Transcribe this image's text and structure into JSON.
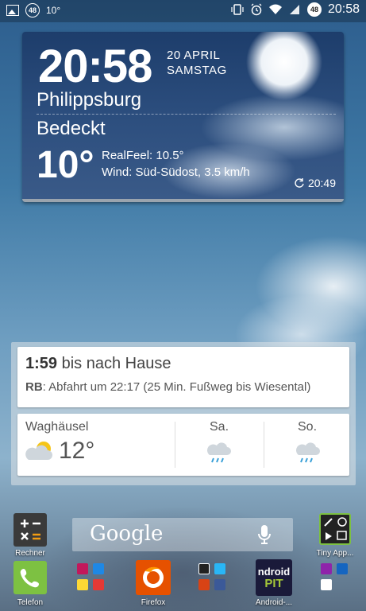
{
  "status_bar": {
    "notif_count": "48",
    "temp": "10°",
    "battery": "48",
    "time": "20:58"
  },
  "weather_widget": {
    "time": "20:58",
    "date_line1": "20 APRIL",
    "date_line2": "SAMSTAG",
    "city": "Philippsburg",
    "condition": "Bedeckt",
    "temperature": "10°",
    "realfeel": "RealFeel: 10.5°",
    "wind": "Wind: Süd-Südost, 3.5 km/h",
    "updated": "20:49"
  },
  "commute_card": {
    "time_bold": "1:59",
    "title_rest": " bis nach Hause",
    "mode": "RB",
    "detail": ": Abfahrt um 22:17 (25 Min. Fußweg bis Wiesental)"
  },
  "weather_card": {
    "city": "Waghäusel",
    "temp": "12°",
    "day1": "Sa.",
    "day2": "So."
  },
  "apps": {
    "calculator": "Rechner",
    "tiny": "Tiny App...",
    "phone": "Telefon",
    "firefox": "Firefox",
    "android": "Android-...",
    "android_logo_1": "ndroid",
    "android_logo_2": "PIT"
  },
  "search": {
    "label": "Google"
  }
}
